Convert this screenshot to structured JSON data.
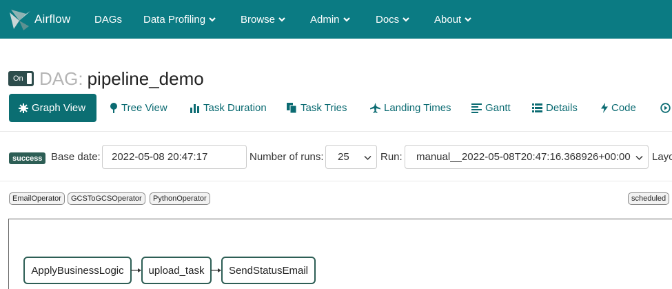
{
  "navbar": {
    "brand": "Airflow",
    "items": [
      {
        "label": "DAGs",
        "dropdown": false
      },
      {
        "label": "Data Profiling",
        "dropdown": true
      },
      {
        "label": "Browse",
        "dropdown": true
      },
      {
        "label": "Admin",
        "dropdown": true
      },
      {
        "label": "Docs",
        "dropdown": true
      },
      {
        "label": "About",
        "dropdown": true
      }
    ]
  },
  "dag": {
    "toggle_label": "On",
    "prefix": "DAG:",
    "id": "pipeline_demo"
  },
  "tabs": [
    {
      "label": "Graph View",
      "icon": "asterisk-icon",
      "active": true
    },
    {
      "label": "Tree View",
      "icon": "tree-icon",
      "active": false
    },
    {
      "label": "Task Duration",
      "icon": "bar-chart-icon",
      "active": false
    },
    {
      "label": "Task Tries",
      "icon": "duplicate-icon",
      "active": false
    },
    {
      "label": "Landing Times",
      "icon": "plane-icon",
      "active": false
    },
    {
      "label": "Gantt",
      "icon": "align-left-icon",
      "active": false
    },
    {
      "label": "Details",
      "icon": "list-icon",
      "active": false
    },
    {
      "label": "Code",
      "icon": "lightning-icon",
      "active": false
    }
  ],
  "form": {
    "status_badge": "success",
    "base_date_label": "Base date:",
    "base_date_value": "2022-05-08 20:47:17",
    "num_runs_label": "Number of runs:",
    "num_runs_value": "25",
    "run_label": "Run:",
    "run_value": "manual__2022-05-08T20:47:16.368926+00:00",
    "layout_label_partial": "Layo"
  },
  "legend": {
    "operators": [
      "EmailOperator",
      "GCSToGCSOperator",
      "PythonOperator"
    ],
    "states": [
      "scheduled"
    ]
  },
  "graph": {
    "nodes": [
      "ApplyBusinessLogic",
      "upload_task",
      "SendStatusEmail"
    ]
  },
  "colors": {
    "navbar": "#0b7b83",
    "active_tab": "#0b6e72",
    "link": "#0b6b72",
    "badge": "#2d5e55",
    "node_border": "#2d5e55"
  }
}
